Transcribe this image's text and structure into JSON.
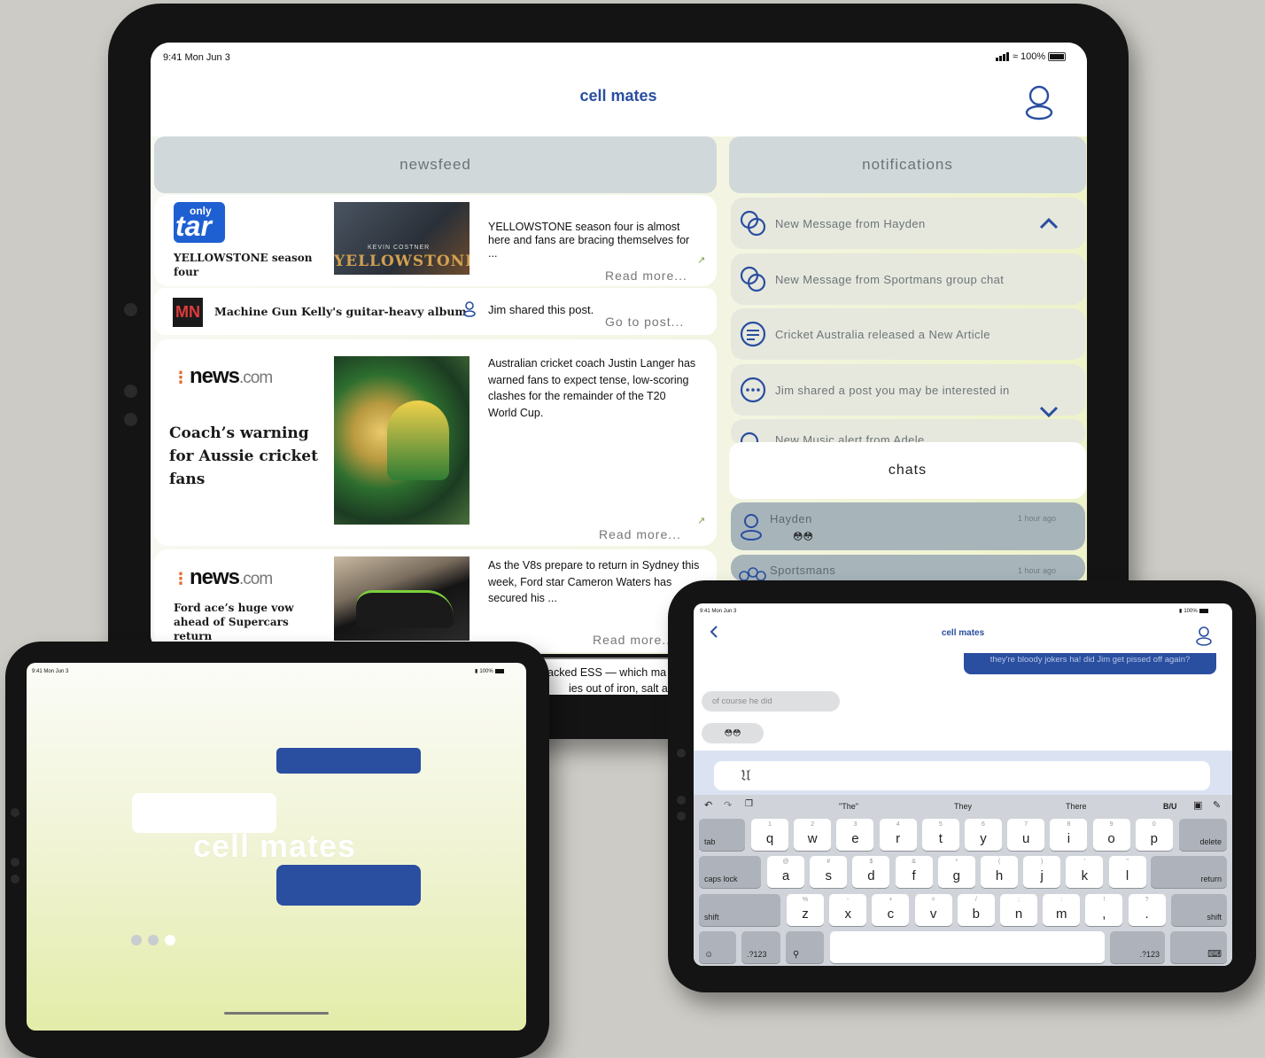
{
  "colors": {
    "accent": "#2a4ea0",
    "header": "#d1d8da",
    "chat_bubble": "#2a4ea0",
    "background": "#cdcbc5"
  },
  "large": {
    "status": {
      "time": "9:41 Mon Jun 3",
      "battery": "100%"
    },
    "title": "cell mates",
    "newsfeed_label": "newsfeed",
    "notifications_label": "notifications",
    "chats_label": "chats",
    "posts": [
      {
        "brand": "only",
        "brand2": "tar",
        "headline": "YELLOWSTONE season four",
        "thumb_caption": "KEVIN COSTNER",
        "thumb_title": "YELLOWSTONE",
        "summary": "YELLOWSTONE season four is almost here and fans are bracing themselves for ...",
        "link": "Read more..."
      },
      {
        "brand": "MN",
        "headline": "Machine Gun Kelly's guitar-heavy album",
        "shared": "Jim shared this post.",
        "link": "Go to post..."
      },
      {
        "brand": "news",
        "brand_suffix": ".com",
        "headline": "Coach’s warning for Aussie cricket fans",
        "summary": "Australian cricket coach Justin Langer has warned fans to expect tense, low-scoring clashes for the remainder of the T20 World Cup.",
        "link": "Read more..."
      },
      {
        "brand": "news",
        "brand_suffix": ".com",
        "headline": "Ford ace’s huge vow ahead of Supercars return",
        "summary": "As the V8s prepare to return in Sydney this week, Ford star Cameron Waters has secured his ...",
        "link": "Read more..."
      }
    ],
    "notifications": [
      {
        "text": "New Message from Hayden",
        "icon": "chat-bubbles-icon"
      },
      {
        "text": "New Message from Sportmans group chat",
        "icon": "chat-bubbles-icon"
      },
      {
        "text": "Cricket Australia released a New Article",
        "icon": "article-icon"
      },
      {
        "text": "Jim shared a post you may be interested in",
        "icon": "dots-chat-icon"
      },
      {
        "text": "New Music alert from Adele",
        "icon": "chat-bubbles-icon"
      }
    ],
    "chats": [
      {
        "name": "Hayden",
        "time": "1 hour ago",
        "preview": "😳😳"
      },
      {
        "name": "Sportsmans",
        "time": "1 hour ago"
      }
    ],
    "footer_fragment": "acked ESS — which ma",
    "footer_fragment2": "ies out of iron, salt and"
  },
  "small_left": {
    "status": {
      "time": "9:41 Mon Jun 3",
      "battery": "100%"
    },
    "title": "cell mates",
    "page_indicator": {
      "pages": 3,
      "active": 3
    }
  },
  "small_right": {
    "status": {
      "time": "9:41 Mon Jun 3",
      "battery": "100%"
    },
    "title": "cell mates",
    "messages": [
      {
        "text": "they're bloody jokers ha! did Jim get pissed off again?",
        "from": "me"
      },
      {
        "text": "of course he did",
        "from": "them"
      },
      {
        "text": "😳😳",
        "from": "them"
      }
    ],
    "predictions": [
      "\"The\"",
      "They",
      "There"
    ],
    "format_label": "B/U",
    "keyboard": {
      "row1": [
        [
          "1",
          "q"
        ],
        [
          "2",
          "w"
        ],
        [
          "3",
          "e"
        ],
        [
          "4",
          "r"
        ],
        [
          "5",
          "t"
        ],
        [
          "6",
          "y"
        ],
        [
          "7",
          "u"
        ],
        [
          "8",
          "i"
        ],
        [
          "9",
          "o"
        ],
        [
          "0",
          "p"
        ]
      ],
      "row2": [
        [
          "@",
          "a"
        ],
        [
          "#",
          "s"
        ],
        [
          "$",
          "d"
        ],
        [
          "&",
          "f"
        ],
        [
          "*",
          "g"
        ],
        [
          "(",
          "h"
        ],
        [
          ")",
          "j"
        ],
        [
          "’",
          "k"
        ],
        [
          "\"",
          "l"
        ]
      ],
      "row3": [
        [
          "%",
          "z"
        ],
        [
          "-",
          "x"
        ],
        [
          "+",
          "c"
        ],
        [
          "=",
          "v"
        ],
        [
          "/",
          "b"
        ],
        [
          ";",
          "n"
        ],
        [
          ":",
          "m"
        ],
        [
          "!",
          ","
        ],
        [
          "?",
          "."
        ]
      ],
      "tab": "tab",
      "delete": "delete",
      "caps": "caps lock",
      "return": "return",
      "shift": "shift",
      "num": ".?123"
    }
  }
}
